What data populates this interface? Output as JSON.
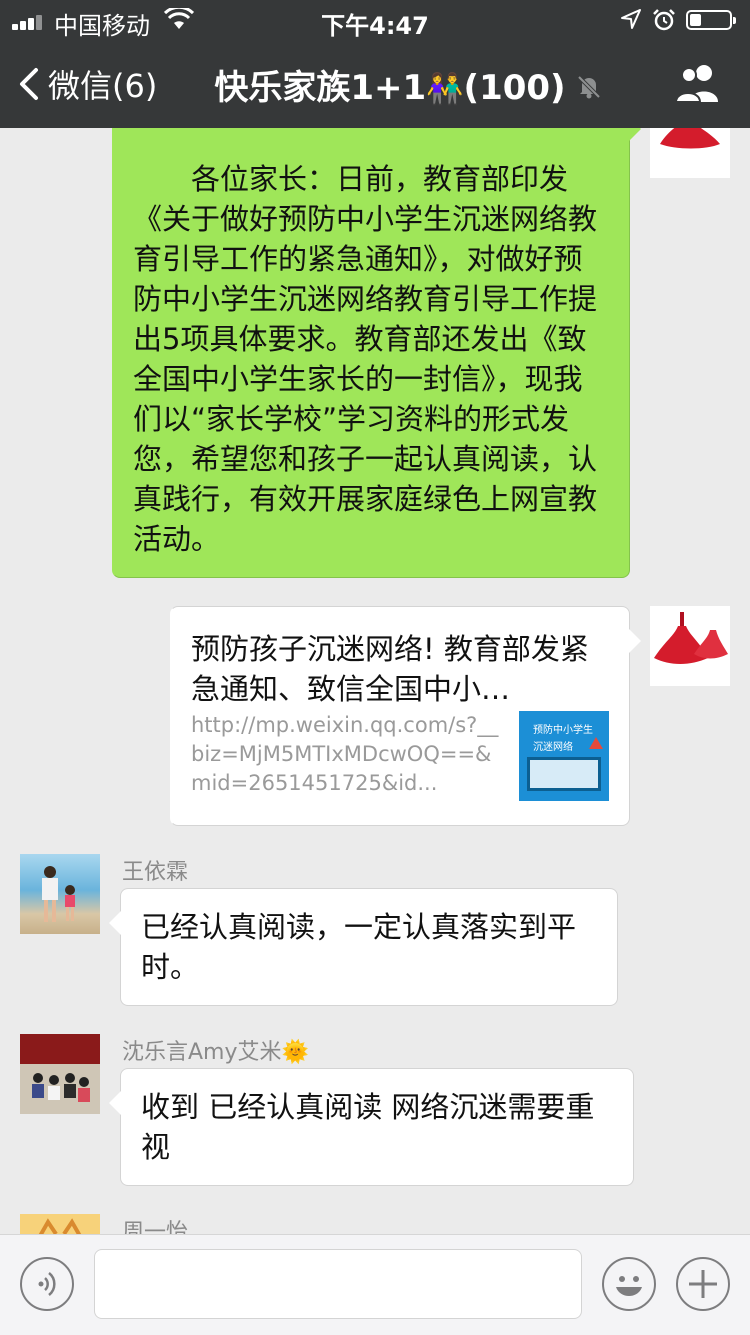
{
  "status_bar": {
    "carrier": "中国移动",
    "time": "下午4:47",
    "battery_level_percent": 30
  },
  "nav": {
    "back_label": "微信(6)",
    "chat_title": "快乐家族1+1",
    "title_emoji": "👫",
    "member_count": "(100)",
    "muted": true
  },
  "messages": [
    {
      "type": "text",
      "side": "right",
      "text": "　　各位家长：日前，教育部印发《关于做好预防中小学生沉迷网络教育引导工作的紧急通知》，对做好预防中小学生沉迷网络教育引导工作提出5项具体要求。教育部还发出《致全国中小学生家长的一封信》，现我们以“家长学校”学习资料的形式发您，希望您和孩子一起认真阅读，认真践行，有效开展家庭绿色上网宣教活动。"
    },
    {
      "type": "link",
      "side": "right",
      "title": "预防孩子沉迷网络! 教育部发紧急通知、致信全国中小…",
      "url": "http://mp.weixin.qq.com/s?__biz=MjM5MTIxMDcwOQ==&mid=2651451725&id...",
      "thumb_text_line1": "预防中小学生",
      "thumb_text_line2": "沉迷网络"
    },
    {
      "type": "text",
      "side": "left",
      "sender": "王依霖",
      "text": "已经认真阅读，一定认真落实到平时。"
    },
    {
      "type": "text",
      "side": "left",
      "sender": "沈乐言Amy艾米",
      "sender_emoji": "🌞",
      "text": "收到 已经认真阅读 网络沉迷需要重视"
    },
    {
      "type": "partial",
      "side": "left",
      "sender": "周一怡"
    }
  ],
  "colors": {
    "nav_bg": "#363839",
    "chat_bg": "#ebebeb",
    "sent_bubble": "#9fe659",
    "received_bubble": "#ffffff"
  }
}
